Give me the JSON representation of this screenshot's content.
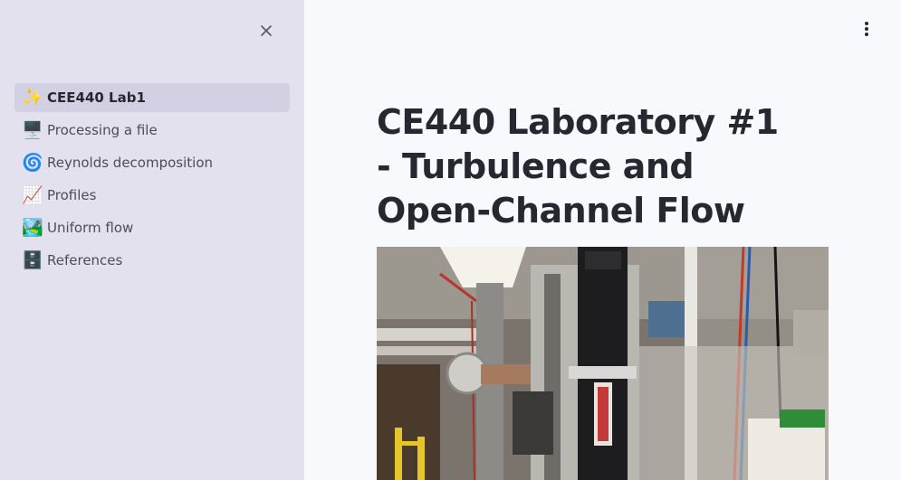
{
  "sidebar": {
    "close_icon": "close-icon",
    "items": [
      {
        "icon": "✨",
        "icon_name": "sparkles-icon",
        "label": "CEE440 Lab1",
        "active": true
      },
      {
        "icon": "🖥️",
        "icon_name": "desktop-computer-icon",
        "label": "Processing a file"
      },
      {
        "icon": "🌀",
        "icon_name": "cyclone-icon",
        "label": "Reynolds decomposition"
      },
      {
        "icon": "📈",
        "icon_name": "chart-increasing-icon",
        "label": "Profiles"
      },
      {
        "icon": "🏞️",
        "icon_name": "national-park-icon",
        "label": "Uniform flow"
      },
      {
        "icon": "🗄️",
        "icon_name": "file-cabinet-icon",
        "label": "References"
      }
    ]
  },
  "header": {
    "menu_icon": "kebab-menu-icon"
  },
  "main": {
    "title": "CE440 Laboratory #1 - Turbulence and Open-Channel Flow",
    "image_subject": "laboratory flume with ADV probe mount"
  },
  "colors": {
    "sidebar_bg": "#e4e1ee",
    "active_item_bg": "#d3d0e3",
    "main_bg": "#f8f9fc",
    "text": "#262730"
  }
}
